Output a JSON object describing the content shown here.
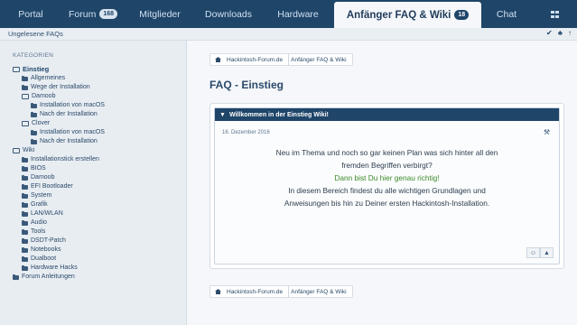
{
  "nav": {
    "tabs": [
      {
        "label": "Portal",
        "badge": ""
      },
      {
        "label": "Forum",
        "badge": "168"
      },
      {
        "label": "Mitglieder",
        "badge": ""
      },
      {
        "label": "Downloads",
        "badge": ""
      },
      {
        "label": "Hardware",
        "badge": ""
      },
      {
        "label": "Anfänger FAQ & Wiki",
        "badge": "18"
      },
      {
        "label": "Chat",
        "badge": ""
      }
    ]
  },
  "subbar": {
    "text": "Ungelesene FAQs"
  },
  "sidebar": {
    "heading": "KATEGORIEN",
    "items": [
      {
        "label": "Einstieg"
      },
      {
        "label": "Allgemeines"
      },
      {
        "label": "Wege der Installation"
      },
      {
        "label": "Damoob"
      },
      {
        "label": "Installation von macOS"
      },
      {
        "label": "Nach der Installation"
      },
      {
        "label": "Clover"
      },
      {
        "label": "Installation von macOS"
      },
      {
        "label": "Nach der Installation"
      },
      {
        "label": "Wiki"
      },
      {
        "label": "Installationstick erstellen"
      },
      {
        "label": "BIOS"
      },
      {
        "label": "Damoob"
      },
      {
        "label": "EFI Bootloader"
      },
      {
        "label": "System"
      },
      {
        "label": "Grafik"
      },
      {
        "label": "LAN/WLAN"
      },
      {
        "label": "Audio"
      },
      {
        "label": "Tools"
      },
      {
        "label": "DSDT-Patch"
      },
      {
        "label": "Notebooks"
      },
      {
        "label": "Dualboot"
      },
      {
        "label": "Hardware Hacks"
      },
      {
        "label": "Forum Anleitungen"
      }
    ]
  },
  "breadcrumb": {
    "items": [
      "Hackintosh-Forum.de",
      "Anfänger FAQ & Wiki"
    ]
  },
  "page": {
    "title": "FAQ - Einstieg"
  },
  "post": {
    "header": "Willkommen in der Einstieg Wiki!",
    "date": "16. Dezember 2016",
    "line1": "Neu im Thema und noch so gar keinen Plan was sich hinter all den",
    "line2": "fremden Begriffen verbirgt?",
    "line3": "Dann bist Du hier genau richtig!",
    "line4": "In diesem Bereich findest du alle wichtigen Grundlagen und",
    "line5": "Anweisungen bis hin zu Deiner ersten Hackintosh-Installation."
  }
}
